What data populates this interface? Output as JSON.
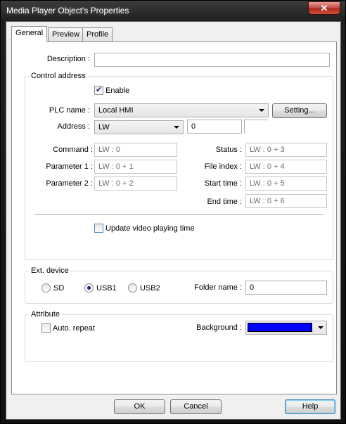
{
  "window": {
    "title": "Media Player Object's Properties",
    "close": "✕"
  },
  "tabs": [
    {
      "label": "General"
    },
    {
      "label": "Preview"
    },
    {
      "label": "Profile"
    }
  ],
  "general": {
    "description_label": "Description :",
    "description_value": ""
  },
  "control_address": {
    "group_label": "Control address",
    "enable_label": "Enable",
    "enable_checked": true,
    "plc_name_label": "PLC name :",
    "plc_name_value": "Local HMI",
    "settings_button": "Setting...",
    "address_label": "Address :",
    "address_type": "LW",
    "address_value": "0",
    "address_extra": "",
    "command_label": "Command :",
    "command_value": "LW : 0",
    "param1_label": "Parameter 1 :",
    "param1_value": "LW : 0 + 1",
    "param2_label": "Parameter 2 :",
    "param2_value": "LW : 0 + 2",
    "status_label": "Status :",
    "status_value": "LW : 0 + 3",
    "file_index_label": "File index :",
    "file_index_value": "LW : 0 + 4",
    "start_time_label": "Start time :",
    "start_time_value": "LW : 0 + 5",
    "end_time_label": "End time :",
    "end_time_value": "LW : 0 + 6",
    "update_label": "Update video playing time",
    "update_checked": false
  },
  "ext_device": {
    "group_label": "Ext. device",
    "options": [
      "SD",
      "USB1",
      "USB2"
    ],
    "selected": "USB1",
    "folder_label": "Folder name :",
    "folder_value": "0"
  },
  "attribute": {
    "group_label": "Attribute",
    "repeat_label": "Auto. repeat",
    "repeat_checked": false,
    "background_label": "Background :",
    "background_color": "#0000ff"
  },
  "footer": {
    "ok": "OK",
    "cancel": "Cancel",
    "help": "Help"
  }
}
